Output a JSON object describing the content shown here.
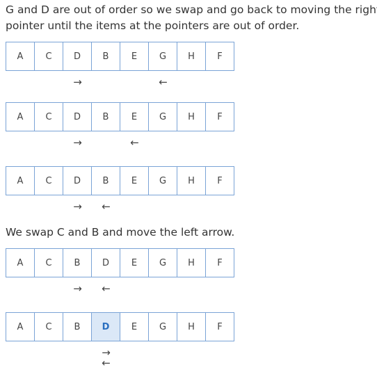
{
  "text": {
    "intro": [
      "G and D are out of order so we swap and go back to moving the right",
      "pointer until the items at the pointers are out of order."
    ],
    "middle": "We swap C and B and move the left arrow."
  },
  "arrows": {
    "right": "→",
    "left": "←"
  },
  "rows": [
    {
      "cells": [
        "A",
        "C",
        "D",
        "B",
        "E",
        "G",
        "H",
        "F"
      ],
      "highlight": -1
    },
    {
      "cells": [
        "A",
        "C",
        "D",
        "B",
        "E",
        "G",
        "H",
        "F"
      ],
      "highlight": -1
    },
    {
      "cells": [
        "A",
        "C",
        "D",
        "B",
        "E",
        "G",
        "H",
        "F"
      ],
      "highlight": -1
    },
    {
      "cells": [
        "A",
        "C",
        "B",
        "D",
        "E",
        "G",
        "H",
        "F"
      ],
      "highlight": -1
    },
    {
      "cells": [
        "A",
        "C",
        "B",
        "D",
        "E",
        "G",
        "H",
        "F"
      ],
      "highlight": 3
    }
  ],
  "pointers": [
    {
      "left_index": 2,
      "right_index": 5
    },
    {
      "left_index": 2,
      "right_index": 4
    },
    {
      "left_index": 2,
      "right_index": 3
    },
    {
      "left_index": 2,
      "right_index": 3
    },
    {
      "left_index": 3,
      "right_index": 3
    }
  ]
}
